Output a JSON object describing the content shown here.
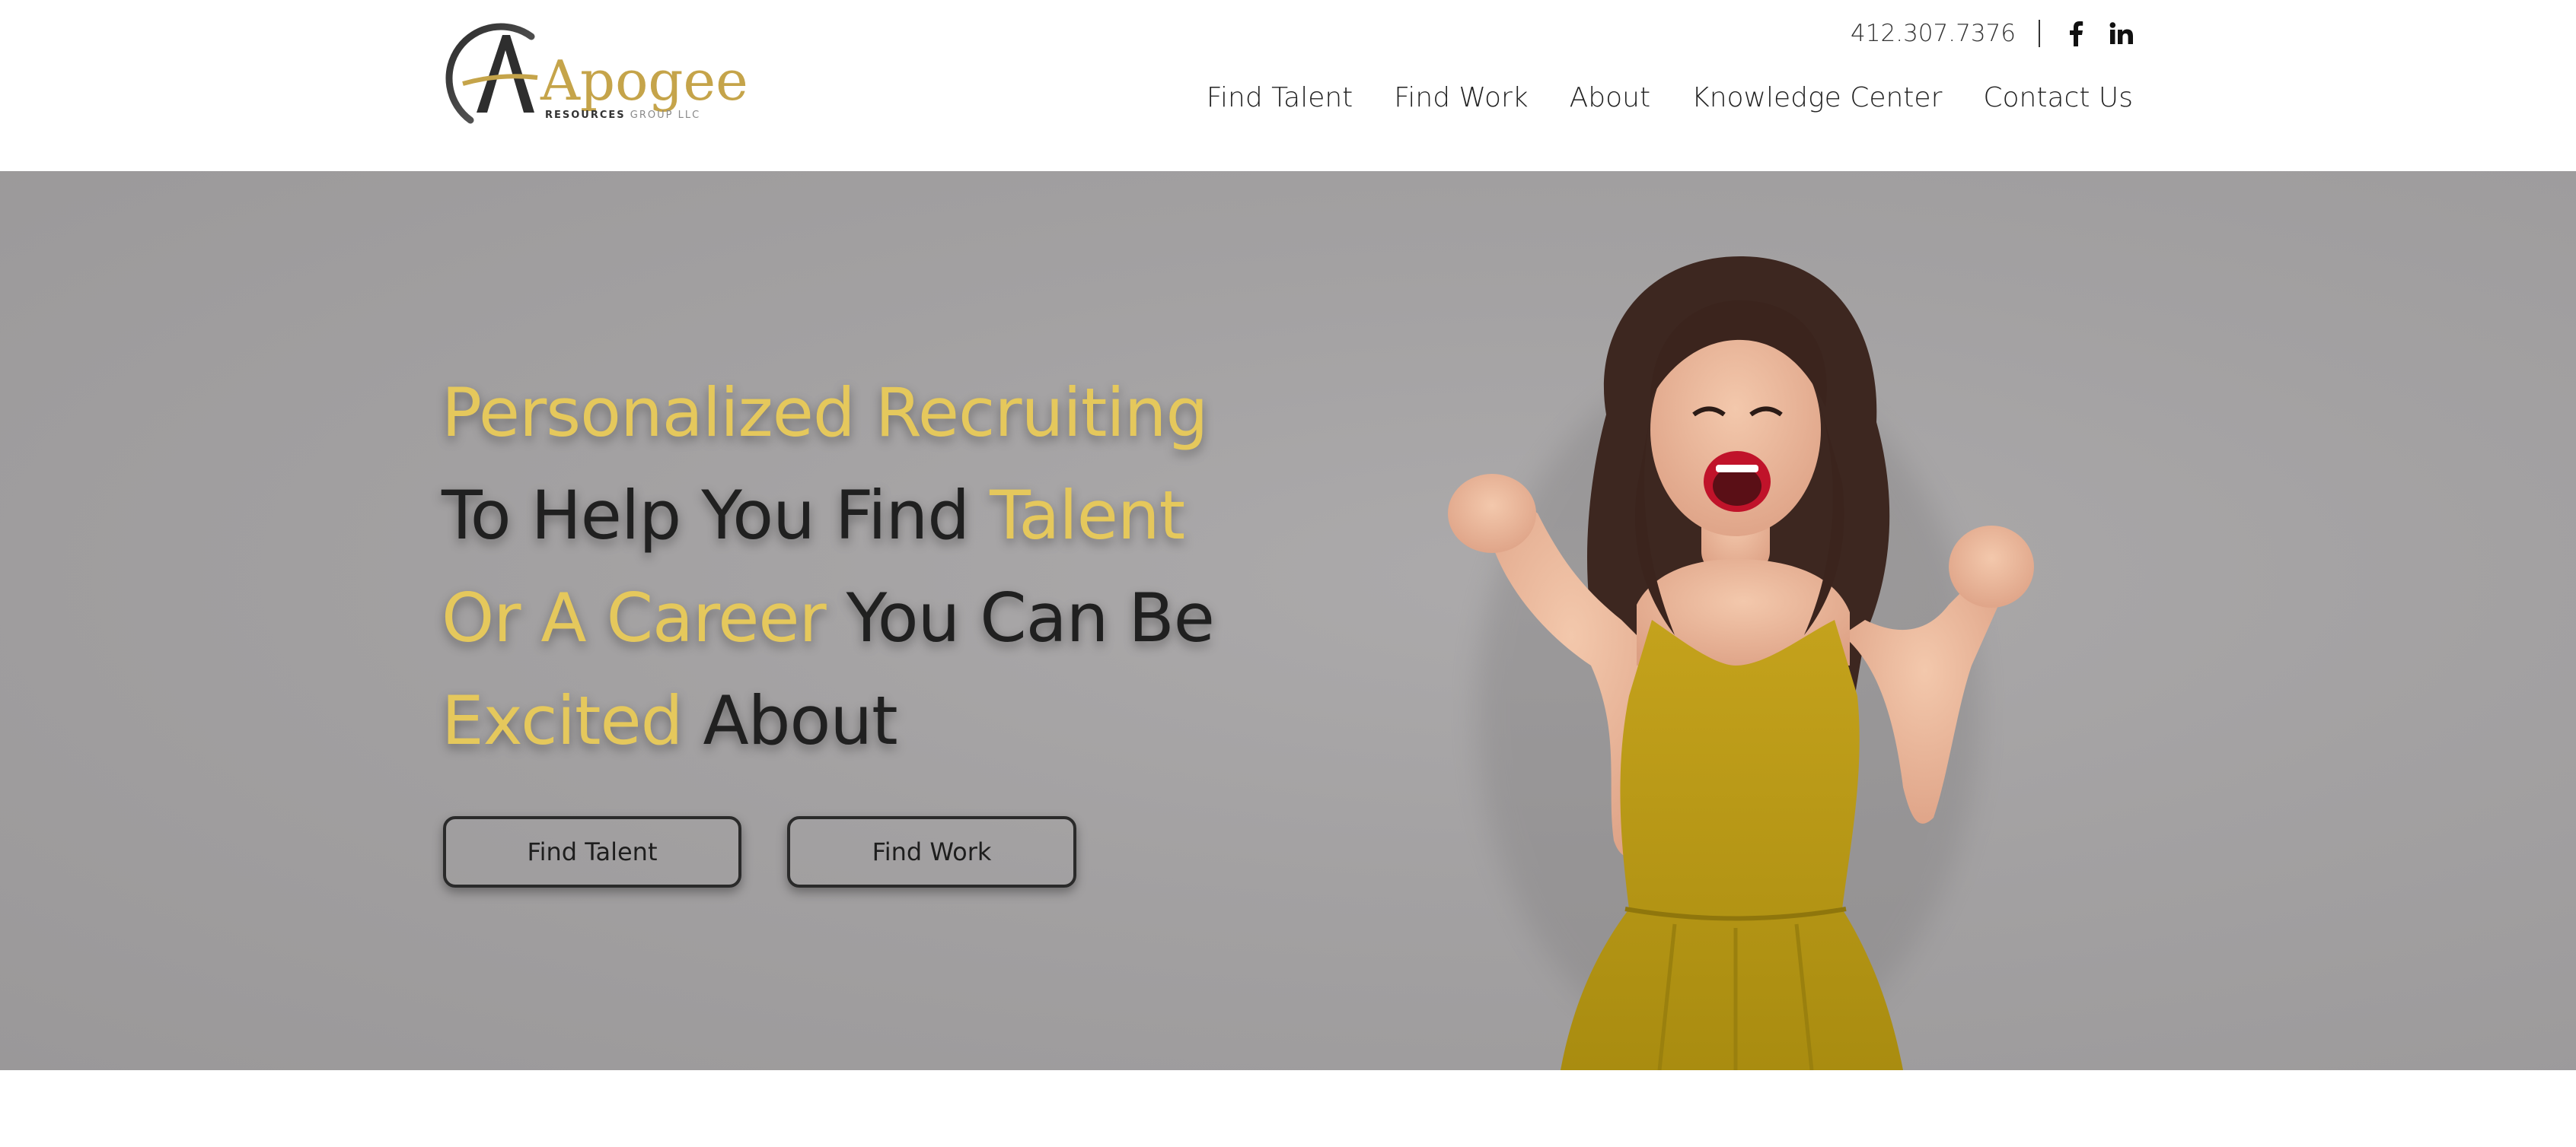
{
  "brand": {
    "name": "Apogee",
    "subtitle_bold": "RESOURCES",
    "subtitle_light": "GROUP LLC"
  },
  "header": {
    "phone": "412.307.7376",
    "social": [
      "facebook-icon",
      "linkedin-icon"
    ],
    "nav": [
      "Find Talent",
      "Find Work",
      "About",
      "Knowledge Center",
      "Contact Us"
    ]
  },
  "hero": {
    "line1_gold": "Personalized Recruiting",
    "line2_dark": "To Help You Find ",
    "line2_gold": "Talent",
    "line3_gold": "Or A Career",
    "line3_dark": " You Can Be",
    "line4_gold": "Excited",
    "line4_dark": " About",
    "buttons": {
      "talent": "Find Talent",
      "work": "Find Work"
    }
  },
  "colors": {
    "accent_gold": "#e5c85c",
    "logo_gold": "#c5a44a",
    "hero_bg": "#a3a1a2",
    "text_dark": "#202020",
    "dress": "#b89a14"
  }
}
